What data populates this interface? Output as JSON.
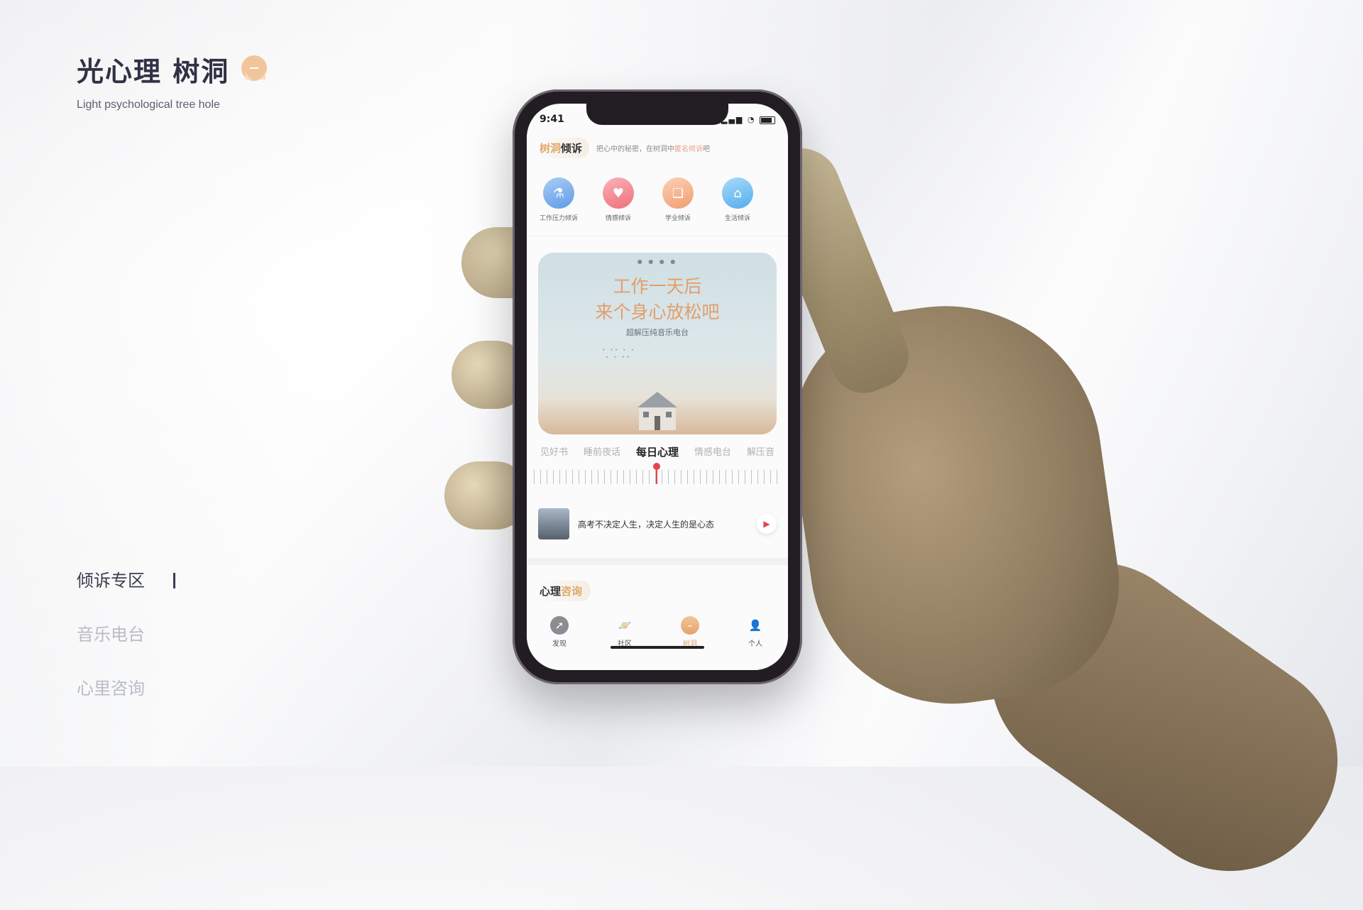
{
  "brand": {
    "title": "光心理 树洞",
    "subtitle": "Light psychological tree hole"
  },
  "side_menu": [
    {
      "label": "倾诉专区",
      "active": true
    },
    {
      "label": "音乐电台",
      "active": false
    },
    {
      "label": "心里咨询",
      "active": false
    }
  ],
  "phone": {
    "status": {
      "time": "9:41"
    },
    "section_title": {
      "plain": "树洞",
      "accent": "倾诉"
    },
    "section_note": {
      "before": "把心中的秘密，在树洞中",
      "accent": "匿名倾诉",
      "after": "吧"
    },
    "categories": [
      {
        "label": "工作压力倾诉",
        "icon": "flask-icon",
        "color": "#6fa6e8"
      },
      {
        "label": "情感倾诉",
        "icon": "heart-icon",
        "color": "#f07f88"
      },
      {
        "label": "学业倾诉",
        "icon": "book-icon",
        "color": "#f2a77f"
      },
      {
        "label": "生活倾诉",
        "icon": "house-icon",
        "color": "#63b3ec"
      }
    ],
    "banner": {
      "line1": "工作一天后",
      "line2": "来个身心放松吧",
      "subtitle": "超解压纯音乐电台"
    },
    "radio_tabs": [
      {
        "label": "见好书",
        "active": false
      },
      {
        "label": "睡前夜话",
        "active": false
      },
      {
        "label": "每日心理",
        "active": true
      },
      {
        "label": "情感电台",
        "active": false
      },
      {
        "label": "解压音",
        "active": false
      }
    ],
    "track": {
      "title": "高考不决定人生，决定人生的是心态"
    },
    "section2_title": {
      "plain": "心理",
      "accent": "咨询"
    },
    "tabbar": [
      {
        "label": "发现",
        "icon": "compass-icon",
        "active": false
      },
      {
        "label": "社区",
        "icon": "planet-icon",
        "active": false
      },
      {
        "label": "树洞",
        "icon": "treehole-icon",
        "active": true
      },
      {
        "label": "个人",
        "icon": "person-icon",
        "active": false
      }
    ]
  }
}
